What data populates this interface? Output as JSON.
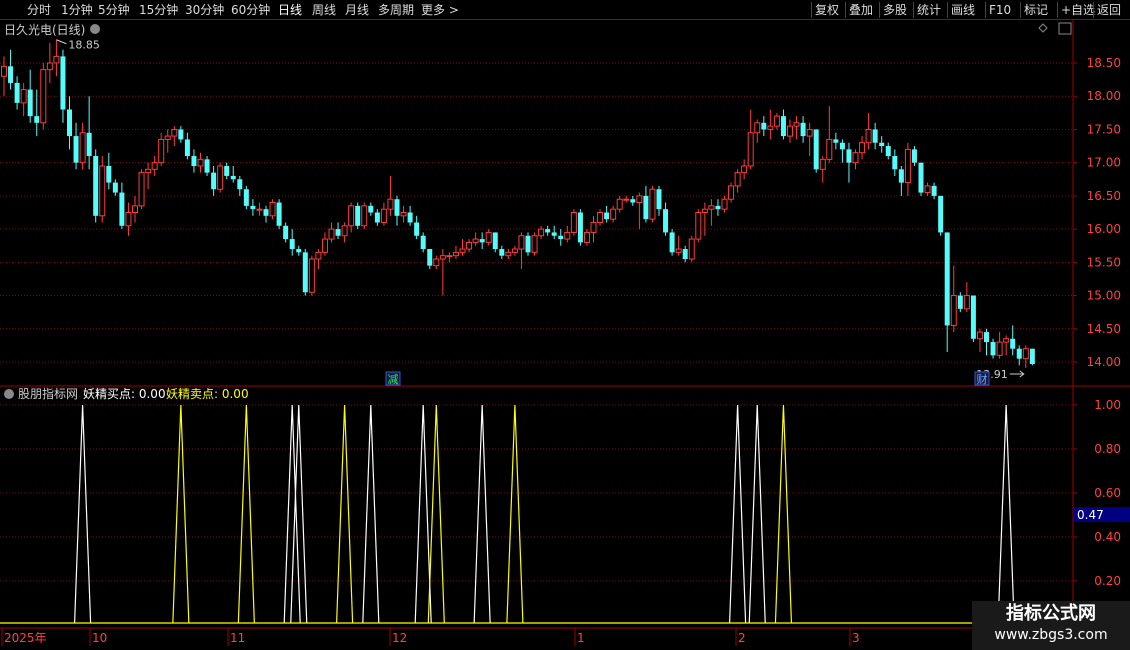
{
  "toolbar": {
    "left": [
      "分时",
      "1分钟",
      "5分钟",
      "15分钟",
      "30分钟",
      "60分钟",
      "日线",
      "周线",
      "月线",
      "多周期",
      "更多 >"
    ],
    "active": "日线",
    "right": [
      "复权",
      "叠加",
      "多股",
      "统计",
      "画线",
      "F10",
      "+自选",
      "返回"
    ],
    "right_extra": "标记"
  },
  "main_panel": {
    "title": "日久光电(日线)",
    "high_label": "18.85",
    "low_label": "13.91",
    "marker_left": "减",
    "marker_right": "财"
  },
  "indicator_panel": {
    "title": "股朋指标网",
    "series1_label": "妖精买点: 0.00",
    "series2_label": "妖精卖点: 0.00",
    "current_value": "0.47"
  },
  "time_axis": {
    "labels": [
      "2025年",
      "10",
      "11",
      "12",
      "1",
      "2",
      "3"
    ]
  },
  "watermark": {
    "title": "指标公式网",
    "url": "www.zbgs3.com"
  },
  "colors": {
    "up": "#ff3b3b",
    "down": "#54fcfc",
    "grid": "#8b0000",
    "axis": "#a00000",
    "buy": "#ffffff",
    "sell": "#ffff00",
    "axis_text": "#ff4040"
  },
  "chart_data": [
    {
      "type": "candlestick",
      "title": "日久光电(日线)",
      "ylim": [
        13.8,
        18.9
      ],
      "yticks": [
        14.0,
        14.5,
        15.0,
        15.5,
        16.0,
        16.5,
        17.0,
        17.5,
        18.0,
        18.5
      ],
      "ohlc": [
        [
          18.3,
          18.6,
          18.0,
          18.45
        ],
        [
          18.45,
          18.7,
          18.1,
          18.2
        ],
        [
          18.2,
          18.3,
          17.8,
          17.9
        ],
        [
          17.9,
          18.2,
          17.7,
          18.1
        ],
        [
          18.1,
          18.4,
          17.6,
          17.7
        ],
        [
          17.7,
          18.1,
          17.4,
          17.6
        ],
        [
          17.6,
          18.5,
          17.5,
          18.4
        ],
        [
          18.4,
          18.8,
          18.2,
          18.5
        ],
        [
          18.5,
          18.85,
          18.3,
          18.6
        ],
        [
          18.6,
          18.7,
          17.6,
          17.8
        ],
        [
          17.8,
          18.0,
          17.2,
          17.4
        ],
        [
          17.4,
          17.6,
          16.9,
          17.0
        ],
        [
          17.0,
          17.6,
          16.9,
          17.45
        ],
        [
          17.45,
          18.0,
          16.9,
          17.1
        ],
        [
          17.1,
          17.2,
          16.1,
          16.2
        ],
        [
          16.2,
          17.1,
          16.1,
          16.95
        ],
        [
          16.95,
          17.15,
          16.6,
          16.7
        ],
        [
          16.7,
          16.75,
          16.5,
          16.55
        ],
        [
          16.55,
          16.7,
          16.0,
          16.05
        ],
        [
          16.05,
          16.4,
          15.9,
          16.25
        ],
        [
          16.25,
          16.5,
          16.1,
          16.35
        ],
        [
          16.35,
          16.9,
          16.3,
          16.85
        ],
        [
          16.85,
          17.0,
          16.6,
          16.9
        ],
        [
          16.9,
          17.1,
          16.8,
          17.0
        ],
        [
          17.0,
          17.45,
          16.95,
          17.35
        ],
        [
          17.35,
          17.5,
          17.15,
          17.4
        ],
        [
          17.4,
          17.55,
          17.25,
          17.5
        ],
        [
          17.5,
          17.55,
          17.3,
          17.35
        ],
        [
          17.35,
          17.45,
          17.05,
          17.1
        ],
        [
          17.1,
          17.2,
          16.85,
          16.95
        ],
        [
          16.95,
          17.15,
          16.85,
          17.05
        ],
        [
          17.05,
          17.1,
          16.8,
          16.85
        ],
        [
          16.85,
          16.95,
          16.5,
          16.6
        ],
        [
          16.6,
          17.0,
          16.55,
          16.95
        ],
        [
          16.95,
          17.0,
          16.75,
          16.8
        ],
        [
          16.8,
          16.95,
          16.7,
          16.75
        ],
        [
          16.75,
          16.8,
          16.5,
          16.6
        ],
        [
          16.6,
          16.65,
          16.3,
          16.35
        ],
        [
          16.35,
          16.45,
          16.2,
          16.3
        ],
        [
          16.3,
          16.4,
          16.2,
          16.3
        ],
        [
          16.3,
          16.35,
          16.1,
          16.2
        ],
        [
          16.2,
          16.45,
          16.15,
          16.4
        ],
        [
          16.4,
          16.45,
          16.0,
          16.05
        ],
        [
          16.05,
          16.1,
          15.8,
          15.85
        ],
        [
          15.85,
          16.0,
          15.6,
          15.7
        ],
        [
          15.7,
          15.75,
          15.6,
          15.65
        ],
        [
          15.65,
          15.7,
          15.0,
          15.05
        ],
        [
          15.05,
          15.6,
          15.0,
          15.55
        ],
        [
          15.55,
          15.7,
          15.4,
          15.65
        ],
        [
          15.65,
          15.95,
          15.6,
          15.85
        ],
        [
          15.85,
          16.1,
          15.8,
          16.0
        ],
        [
          16.0,
          16.1,
          15.85,
          15.9
        ],
        [
          15.9,
          16.1,
          15.8,
          16.05
        ],
        [
          16.05,
          16.4,
          15.95,
          16.35
        ],
        [
          16.35,
          16.4,
          16.0,
          16.05
        ],
        [
          16.05,
          16.4,
          16.0,
          16.35
        ],
        [
          16.35,
          16.4,
          16.2,
          16.25
        ],
        [
          16.25,
          16.3,
          16.05,
          16.1
        ],
        [
          16.1,
          16.4,
          16.05,
          16.3
        ],
        [
          16.3,
          16.8,
          16.2,
          16.45
        ],
        [
          16.45,
          16.5,
          16.05,
          16.2
        ],
        [
          16.2,
          16.35,
          16.1,
          16.25
        ],
        [
          16.25,
          16.35,
          16.05,
          16.1
        ],
        [
          16.1,
          16.2,
          15.85,
          15.9
        ],
        [
          15.9,
          15.95,
          15.65,
          15.7
        ],
        [
          15.7,
          15.7,
          15.4,
          15.45
        ],
        [
          15.45,
          15.6,
          15.4,
          15.55
        ],
        [
          15.55,
          15.7,
          15.0,
          15.6
        ],
        [
          15.6,
          15.65,
          15.5,
          15.6
        ],
        [
          15.6,
          15.75,
          15.55,
          15.65
        ],
        [
          15.65,
          15.85,
          15.6,
          15.7
        ],
        [
          15.7,
          15.85,
          15.65,
          15.8
        ],
        [
          15.8,
          15.95,
          15.75,
          15.85
        ],
        [
          15.85,
          15.95,
          15.7,
          15.8
        ],
        [
          15.8,
          16.0,
          15.75,
          15.95
        ],
        [
          15.95,
          15.95,
          15.65,
          15.7
        ],
        [
          15.7,
          15.75,
          15.55,
          15.6
        ],
        [
          15.6,
          15.7,
          15.55,
          15.65
        ],
        [
          15.65,
          15.75,
          15.6,
          15.7
        ],
        [
          15.7,
          15.95,
          15.4,
          15.9
        ],
        [
          15.9,
          15.95,
          15.6,
          15.65
        ],
        [
          15.65,
          15.95,
          15.6,
          15.9
        ],
        [
          15.9,
          16.05,
          15.85,
          16.0
        ],
        [
          16.0,
          16.05,
          15.9,
          15.95
        ],
        [
          15.95,
          16.05,
          15.85,
          15.9
        ],
        [
          15.9,
          16.0,
          15.75,
          15.85
        ],
        [
          15.85,
          16.05,
          15.8,
          15.95
        ],
        [
          15.95,
          16.3,
          15.9,
          16.25
        ],
        [
          16.25,
          16.3,
          15.75,
          15.8
        ],
        [
          15.8,
          16.0,
          15.75,
          15.95
        ],
        [
          15.95,
          16.2,
          15.8,
          16.1
        ],
        [
          16.1,
          16.3,
          16.05,
          16.25
        ],
        [
          16.25,
          16.35,
          16.1,
          16.15
        ],
        [
          16.15,
          16.35,
          16.1,
          16.3
        ],
        [
          16.3,
          16.5,
          16.25,
          16.45
        ],
        [
          16.45,
          16.5,
          16.4,
          16.45
        ],
        [
          16.45,
          16.5,
          16.35,
          16.4
        ],
        [
          16.4,
          16.55,
          16.0,
          16.5
        ],
        [
          16.5,
          16.65,
          16.1,
          16.15
        ],
        [
          16.15,
          16.65,
          16.1,
          16.6
        ],
        [
          16.6,
          16.65,
          16.2,
          16.3
        ],
        [
          16.3,
          16.4,
          15.9,
          15.95
        ],
        [
          15.95,
          16.0,
          15.6,
          15.65
        ],
        [
          15.65,
          15.9,
          15.6,
          15.7
        ],
        [
          15.7,
          15.75,
          15.5,
          15.55
        ],
        [
          15.55,
          15.9,
          15.5,
          15.85
        ],
        [
          15.85,
          16.3,
          15.8,
          16.25
        ],
        [
          16.25,
          16.4,
          15.9,
          16.3
        ],
        [
          16.3,
          16.45,
          16.05,
          16.35
        ],
        [
          16.35,
          16.45,
          16.2,
          16.3
        ],
        [
          16.3,
          16.5,
          16.25,
          16.45
        ],
        [
          16.45,
          16.7,
          16.4,
          16.65
        ],
        [
          16.65,
          16.9,
          16.55,
          16.85
        ],
        [
          16.85,
          17.05,
          16.75,
          16.95
        ],
        [
          16.95,
          17.8,
          16.9,
          17.45
        ],
        [
          17.45,
          17.65,
          17.3,
          17.6
        ],
        [
          17.6,
          17.7,
          17.4,
          17.5
        ],
        [
          17.5,
          17.8,
          17.35,
          17.55
        ],
        [
          17.55,
          17.75,
          17.5,
          17.7
        ],
        [
          17.7,
          17.8,
          17.35,
          17.4
        ],
        [
          17.4,
          17.65,
          17.3,
          17.55
        ],
        [
          17.55,
          17.7,
          17.35,
          17.6
        ],
        [
          17.6,
          17.7,
          17.3,
          17.4
        ],
        [
          17.4,
          17.6,
          17.1,
          17.5
        ],
        [
          17.5,
          17.5,
          16.85,
          16.9
        ],
        [
          16.9,
          17.1,
          16.7,
          17.05
        ],
        [
          17.05,
          17.85,
          17.0,
          17.35
        ],
        [
          17.35,
          17.45,
          17.2,
          17.3
        ],
        [
          17.3,
          17.35,
          17.0,
          17.2
        ],
        [
          17.2,
          17.3,
          16.7,
          17.0
        ],
        [
          17.0,
          17.2,
          16.9,
          17.15
        ],
        [
          17.15,
          17.4,
          17.05,
          17.3
        ],
        [
          17.3,
          17.75,
          17.2,
          17.5
        ],
        [
          17.5,
          17.6,
          17.2,
          17.3
        ],
        [
          17.3,
          17.4,
          17.15,
          17.25
        ],
        [
          17.25,
          17.3,
          17.05,
          17.1
        ],
        [
          17.1,
          17.2,
          16.8,
          16.9
        ],
        [
          16.9,
          16.95,
          16.5,
          16.7
        ],
        [
          16.7,
          17.3,
          16.5,
          17.2
        ],
        [
          17.2,
          17.25,
          16.95,
          17.0
        ],
        [
          17.0,
          17.0,
          16.5,
          16.55
        ],
        [
          16.55,
          16.7,
          16.5,
          16.65
        ],
        [
          16.65,
          16.7,
          16.45,
          16.5
        ],
        [
          16.5,
          16.5,
          15.9,
          15.95
        ],
        [
          15.95,
          15.95,
          14.15,
          14.55
        ],
        [
          14.55,
          15.45,
          14.45,
          15.0
        ],
        [
          15.0,
          15.05,
          14.75,
          14.8
        ],
        [
          14.8,
          15.2,
          14.75,
          15.0
        ],
        [
          15.0,
          15.0,
          14.3,
          14.35
        ],
        [
          14.35,
          14.5,
          14.15,
          14.45
        ],
        [
          14.45,
          14.5,
          14.1,
          14.3
        ],
        [
          14.3,
          14.35,
          14.05,
          14.1
        ],
        [
          14.1,
          14.45,
          14.05,
          14.3
        ],
        [
          14.3,
          14.4,
          14.1,
          14.35
        ],
        [
          14.35,
          14.55,
          14.1,
          14.2
        ],
        [
          14.2,
          14.25,
          13.95,
          14.05
        ],
        [
          14.05,
          14.25,
          13.91,
          14.2
        ],
        [
          14.2,
          14.2,
          13.95,
          13.97
        ]
      ]
    },
    {
      "type": "line",
      "title": "股朋指标网",
      "ylim": [
        0.0,
        1.08
      ],
      "yticks": [
        0.2,
        0.4,
        0.6,
        0.8,
        1.0
      ],
      "series": [
        {
          "name": "妖精买点",
          "spikes": [
            12,
            44,
            45,
            56,
            64,
            73,
            112,
            115,
            153
          ]
        },
        {
          "name": "妖精卖点",
          "spikes": [
            27,
            37,
            52,
            66,
            78,
            119
          ]
        }
      ]
    }
  ]
}
